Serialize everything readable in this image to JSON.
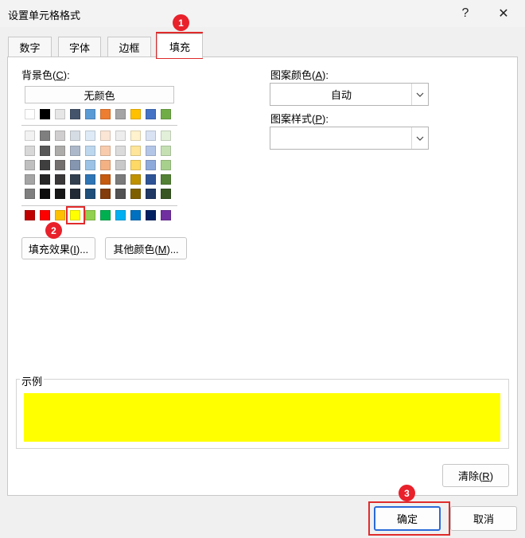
{
  "window": {
    "title": "设置单元格格式",
    "help_glyph": "?",
    "close_glyph": "✕"
  },
  "tabs": [
    {
      "label": "数字"
    },
    {
      "label": "字体"
    },
    {
      "label": "边框"
    },
    {
      "label": "填充",
      "active": true
    }
  ],
  "background": {
    "label_prefix": "背景色(",
    "label_key": "C",
    "label_suffix": "):",
    "no_color_label": "无颜色",
    "theme_row_colors": [
      "#ffffff",
      "#000000",
      "#e7e6e6",
      "#44546a",
      "#5b9bd5",
      "#ed7d31",
      "#a5a5a5",
      "#ffc000",
      "#4472c4",
      "#70ad47"
    ],
    "theme_shades": [
      [
        "#f2f2f2",
        "#7f7f7f",
        "#d0cece",
        "#d6dce4",
        "#deebf6",
        "#fbe5d5",
        "#ededed",
        "#fff2cc",
        "#d9e2f3",
        "#e2efd9"
      ],
      [
        "#d8d8d8",
        "#595959",
        "#aeabab",
        "#adb9ca",
        "#bdd7ee",
        "#f7cbac",
        "#dbdbdb",
        "#fee599",
        "#b4c6e7",
        "#c5e0b3"
      ],
      [
        "#bfbfbf",
        "#3f3f3f",
        "#757070",
        "#8496b0",
        "#9cc3e5",
        "#f4b183",
        "#c9c9c9",
        "#ffd965",
        "#8eaadb",
        "#a8d08d"
      ],
      [
        "#a5a5a5",
        "#262626",
        "#3a3838",
        "#323f4f",
        "#2e75b5",
        "#c55a11",
        "#7b7b7b",
        "#bf9000",
        "#2f5496",
        "#538135"
      ],
      [
        "#7f7f7f",
        "#0c0c0c",
        "#171616",
        "#222a35",
        "#1e4e79",
        "#833c0b",
        "#525252",
        "#7f6000",
        "#1f3864",
        "#375623"
      ]
    ],
    "standard_colors": [
      "#c00000",
      "#ff0000",
      "#ffc000",
      "#ffff00",
      "#92d050",
      "#00b050",
      "#00b0f0",
      "#0070c0",
      "#002060",
      "#7030a0"
    ],
    "fill_effects_label": {
      "prefix": "填充效果(",
      "key": "I",
      "suffix": ")..."
    },
    "more_colors_label": {
      "prefix": "其他颜色(",
      "key": "M",
      "suffix": ")..."
    }
  },
  "pattern": {
    "color_label": {
      "prefix": "图案颜色(",
      "key": "A",
      "suffix": "):"
    },
    "color_value": "自动",
    "style_label": {
      "prefix": "图案样式(",
      "key": "P",
      "suffix": "):"
    },
    "style_value": ""
  },
  "sample": {
    "label": "示例",
    "color": "#ffff00"
  },
  "buttons": {
    "clear": {
      "prefix": "清除(",
      "key": "R",
      "suffix": ")"
    },
    "ok": "确定",
    "cancel": "取消"
  },
  "annotations": {
    "step1": "1",
    "step2": "2",
    "step3": "3",
    "highlight_color": "#e02b2b"
  }
}
